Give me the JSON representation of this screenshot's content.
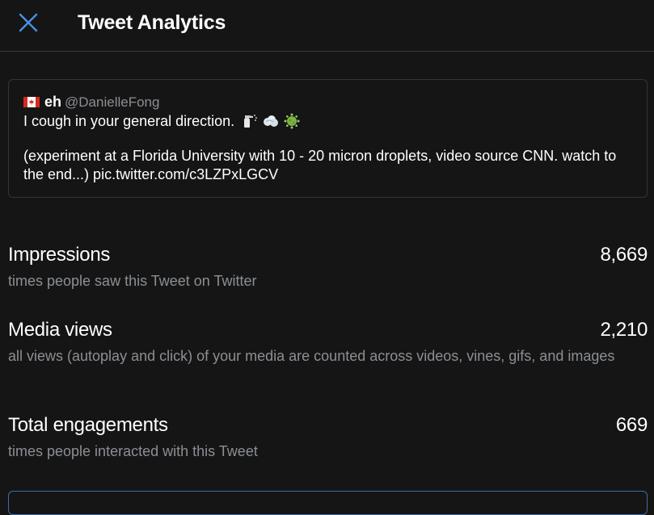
{
  "header": {
    "title": "Tweet Analytics",
    "close_icon": "close-icon",
    "accent_color": "#4a90e2"
  },
  "tweet": {
    "author_flag": "canada-flag-icon",
    "author_name": "eh",
    "author_handle": "@DanielleFong",
    "line1": "I cough in your general direction.",
    "line1_emojis": [
      "spray-bottle-icon",
      "sneeze-cloud-icon",
      "virus-icon"
    ],
    "line2": "(experiment at a Florida University with 10 - 20 micron droplets, video source CNN. watch to the end...) pic.twitter.com/c3LZPxLGCV"
  },
  "metrics": [
    {
      "label": "Impressions",
      "value": "8,669",
      "description": "times people saw this Tweet on Twitter"
    },
    {
      "label": "Media views",
      "value": "2,210",
      "description": "all views (autoplay and click) of your media are counted across videos, vines, gifs, and images"
    },
    {
      "label": "Total engagements",
      "value": "669",
      "description": "times people interacted with this Tweet"
    }
  ]
}
